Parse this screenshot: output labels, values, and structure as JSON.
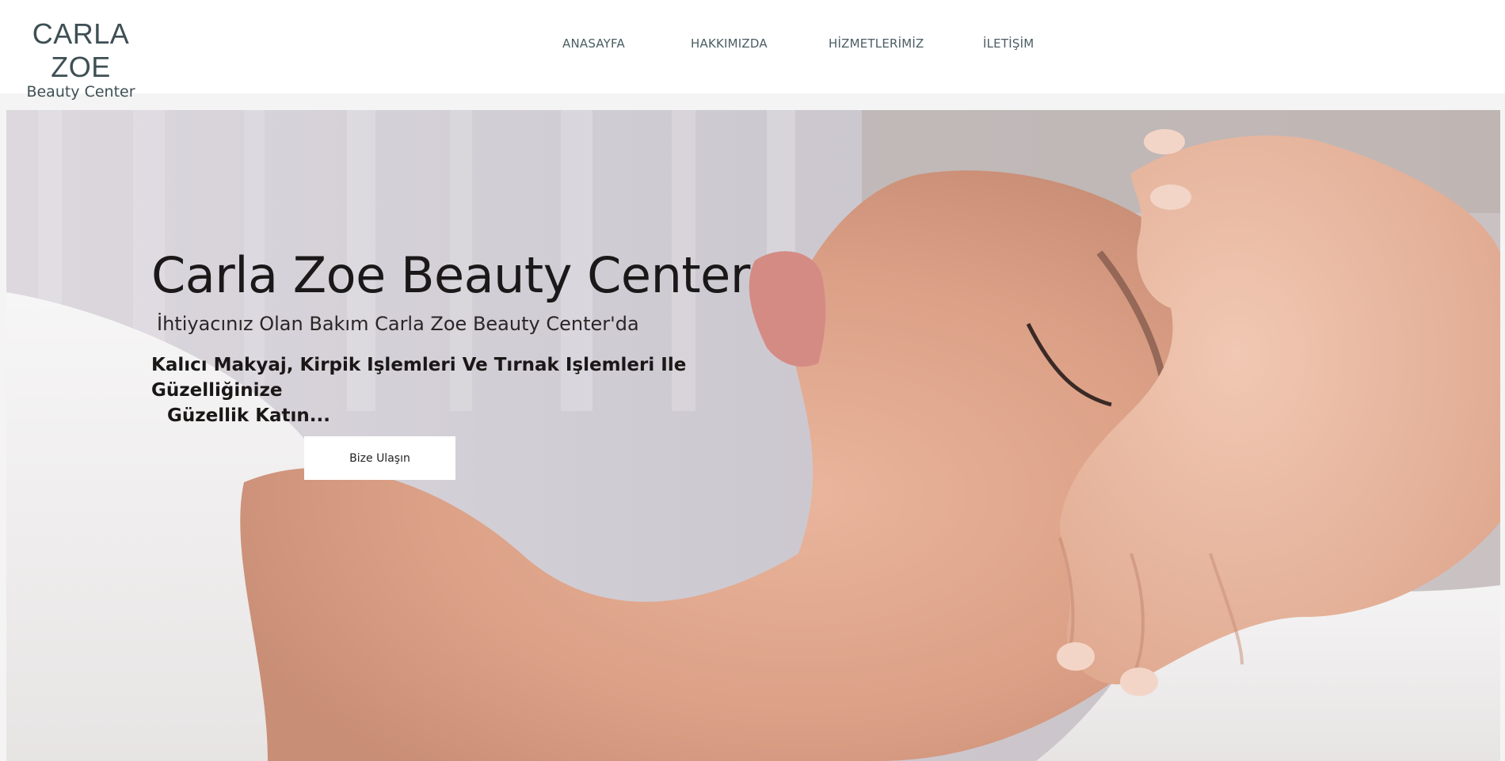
{
  "header": {
    "logo_main": "CARLA ZOE",
    "logo_sub": "Beauty Center"
  },
  "nav": {
    "items": [
      {
        "label": "ANASAYFA"
      },
      {
        "label": "HAKKIMIZDA"
      },
      {
        "label": "HİZMETLERİMİZ"
      },
      {
        "label": "İLETİŞİM"
      }
    ]
  },
  "hero": {
    "title": "Carla Zoe Beauty Center",
    "subtitle": "İhtiyacınız Olan Bakım Carla Zoe Beauty Center'da",
    "tagline_line1": "Kalıcı Makyaj, Kirpik Işlemleri Ve Tırnak Işlemleri Ile Güzelliğinize",
    "tagline_line2": "Güzellik Katın...",
    "cta_label": "Bize Ulaşın"
  },
  "colors": {
    "header_bg": "#ffffff",
    "logo_color": "#3e4f54",
    "nav_color": "#4a5d63",
    "page_bg": "#f4f4f4",
    "button_bg": "#ffffff"
  }
}
